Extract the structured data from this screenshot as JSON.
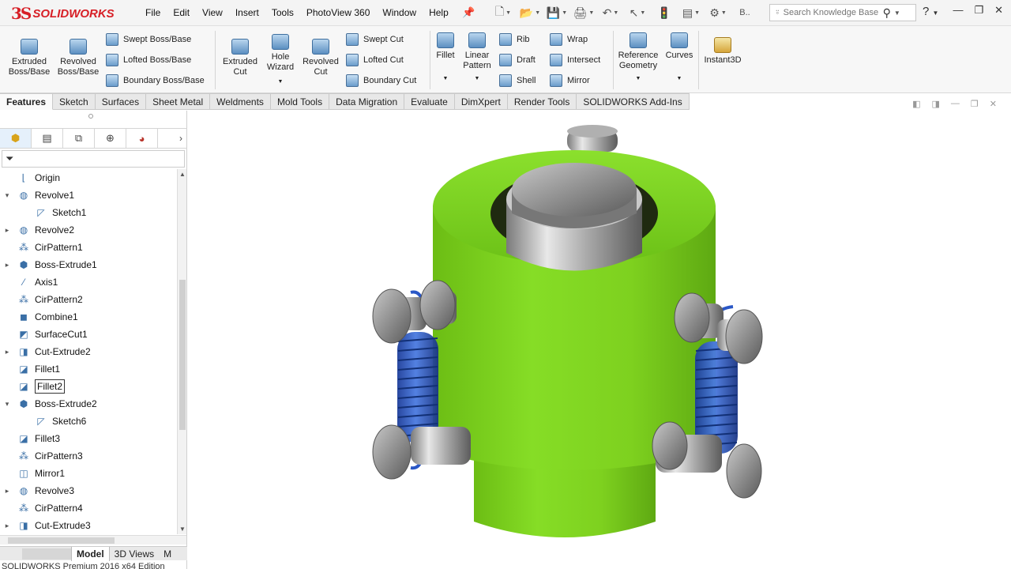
{
  "app": {
    "brand_mark": "3S",
    "brand_name": "SOLIDWORKS"
  },
  "menu": [
    "File",
    "Edit",
    "View",
    "Insert",
    "Tools",
    "PhotoView 360",
    "Window",
    "Help"
  ],
  "quick_access": {
    "overflow_label": "B.."
  },
  "search": {
    "placeholder": "Search Knowledge Base"
  },
  "ribbon": {
    "extruded_boss": "Extruded Boss/Base",
    "revolved_boss": "Revolved Boss/Base",
    "swept_boss": "Swept Boss/Base",
    "lofted_boss": "Lofted Boss/Base",
    "boundary_boss": "Boundary Boss/Base",
    "extruded_cut": "Extruded Cut",
    "hole_wizard": "Hole Wizard",
    "revolved_cut": "Revolved Cut",
    "swept_cut": "Swept Cut",
    "lofted_cut": "Lofted Cut",
    "boundary_cut": "Boundary Cut",
    "fillet": "Fillet",
    "linear_pattern": "Linear Pattern",
    "rib": "Rib",
    "draft": "Draft",
    "shell": "Shell",
    "wrap": "Wrap",
    "intersect": "Intersect",
    "mirror": "Mirror",
    "reference_geometry": "Reference Geometry",
    "curves": "Curves",
    "instant3d": "Instant3D"
  },
  "command_tabs": [
    "Features",
    "Sketch",
    "Surfaces",
    "Sheet Metal",
    "Weldments",
    "Mold Tools",
    "Data Migration",
    "Evaluate",
    "DimXpert",
    "Render Tools",
    "SOLIDWORKS Add-Ins"
  ],
  "active_command_tab": "Features",
  "feature_tree": [
    {
      "label": "Origin",
      "icon": "origin-icon",
      "expander": ""
    },
    {
      "label": "Revolve1",
      "icon": "revolve-icon",
      "expander": "▾"
    },
    {
      "label": "Sketch1",
      "icon": "sketch-icon",
      "expander": "",
      "child": true
    },
    {
      "label": "Revolve2",
      "icon": "revolve-icon",
      "expander": "▸"
    },
    {
      "label": "CirPattern1",
      "icon": "pattern-icon",
      "expander": ""
    },
    {
      "label": "Boss-Extrude1",
      "icon": "extrude-icon",
      "expander": "▸"
    },
    {
      "label": "Axis1",
      "icon": "axis-icon",
      "expander": ""
    },
    {
      "label": "CirPattern2",
      "icon": "pattern-icon",
      "expander": ""
    },
    {
      "label": "Combine1",
      "icon": "combine-icon",
      "expander": ""
    },
    {
      "label": "SurfaceCut1",
      "icon": "surface-cut-icon",
      "expander": ""
    },
    {
      "label": "Cut-Extrude2",
      "icon": "cut-extrude-icon",
      "expander": "▸"
    },
    {
      "label": "Fillet1",
      "icon": "fillet-icon",
      "expander": ""
    },
    {
      "label": "Fillet2",
      "icon": "fillet-icon",
      "expander": "",
      "selected": true
    },
    {
      "label": "Boss-Extrude2",
      "icon": "extrude-icon",
      "expander": "▾"
    },
    {
      "label": "Sketch6",
      "icon": "sketch-icon",
      "expander": "",
      "child": true
    },
    {
      "label": "Fillet3",
      "icon": "fillet-icon",
      "expander": ""
    },
    {
      "label": "CirPattern3",
      "icon": "pattern-icon",
      "expander": ""
    },
    {
      "label": "Mirror1",
      "icon": "mirror-icon",
      "expander": ""
    },
    {
      "label": "Revolve3",
      "icon": "revolve-icon",
      "expander": "▸"
    },
    {
      "label": "CirPattern4",
      "icon": "pattern-icon",
      "expander": ""
    },
    {
      "label": "Cut-Extrude3",
      "icon": "cut-extrude-icon",
      "expander": "▸"
    }
  ],
  "bottom_tabs": [
    "Model",
    "3D Views",
    "M"
  ],
  "active_bottom_tab": "Model",
  "status": "SOLIDWORKS Premium 2016 x64 Edition",
  "colors": {
    "brand": "#d71f26",
    "part_green": "#7bd320",
    "spring_blue": "#2a57c6"
  }
}
